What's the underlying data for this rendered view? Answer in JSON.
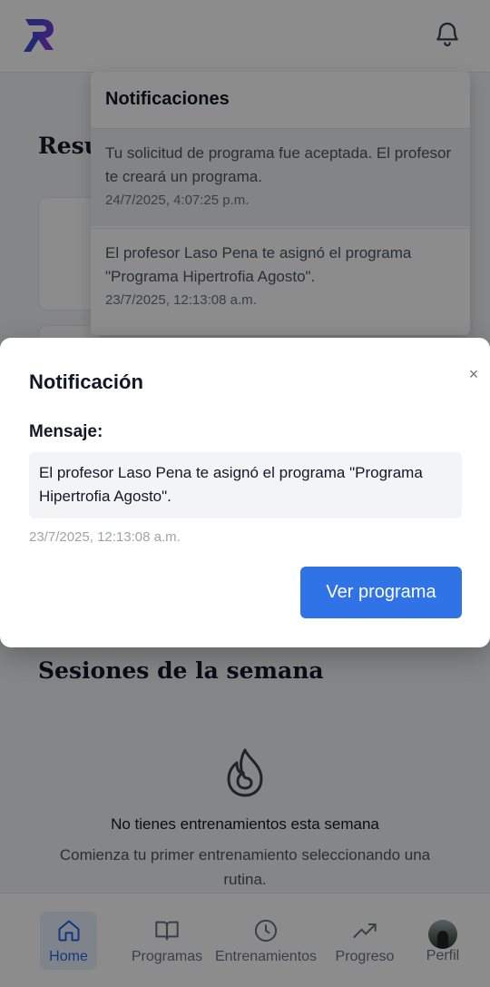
{
  "header": {
    "logo_icon": "r-logo-icon",
    "notifications_icon": "bell-icon"
  },
  "background": {
    "summary_title": "Resumen",
    "week_sessions_title": "Sesiones de la semana",
    "empty_state": {
      "icon": "flame-icon",
      "title": "No tienes entrenamientos esta semana",
      "subtitle": "Comienza tu primer entrenamiento seleccionando una rutina."
    }
  },
  "notifications_dropdown": {
    "title": "Notificaciones",
    "items": [
      {
        "text": "Tu solicitud de programa fue aceptada. El profesor te creará un programa.",
        "time": "24/7/2025, 4:07:25 p.m."
      },
      {
        "text": "El profesor Laso Pena te asignó el programa \"Programa Hipertrofia Agosto\".",
        "time": "23/7/2025, 12:13:08 a.m."
      }
    ]
  },
  "modal": {
    "title": "Notificación",
    "close_label": "×",
    "message_label": "Mensaje:",
    "message": "El profesor Laso Pena te asignó el programa \"Programa Hipertrofia Agosto\".",
    "time": "23/7/2025, 12:13:08 a.m.",
    "action_label": "Ver programa"
  },
  "bottom_nav": {
    "items": [
      {
        "label": "Home",
        "icon": "home-icon",
        "active": true
      },
      {
        "label": "Programas",
        "icon": "book-icon",
        "active": false
      },
      {
        "label": "Entrenamientos",
        "icon": "clock-icon",
        "active": false
      },
      {
        "label": "Progreso",
        "icon": "trending-up-icon",
        "active": false
      },
      {
        "label": "Perfil",
        "icon": "avatar",
        "active": false
      }
    ]
  },
  "colors": {
    "primary": "#2f73e6",
    "active_nav": "#2563eb",
    "logo_gradient_start": "#3b4bd8",
    "logo_gradient_end": "#8a3ad8"
  }
}
